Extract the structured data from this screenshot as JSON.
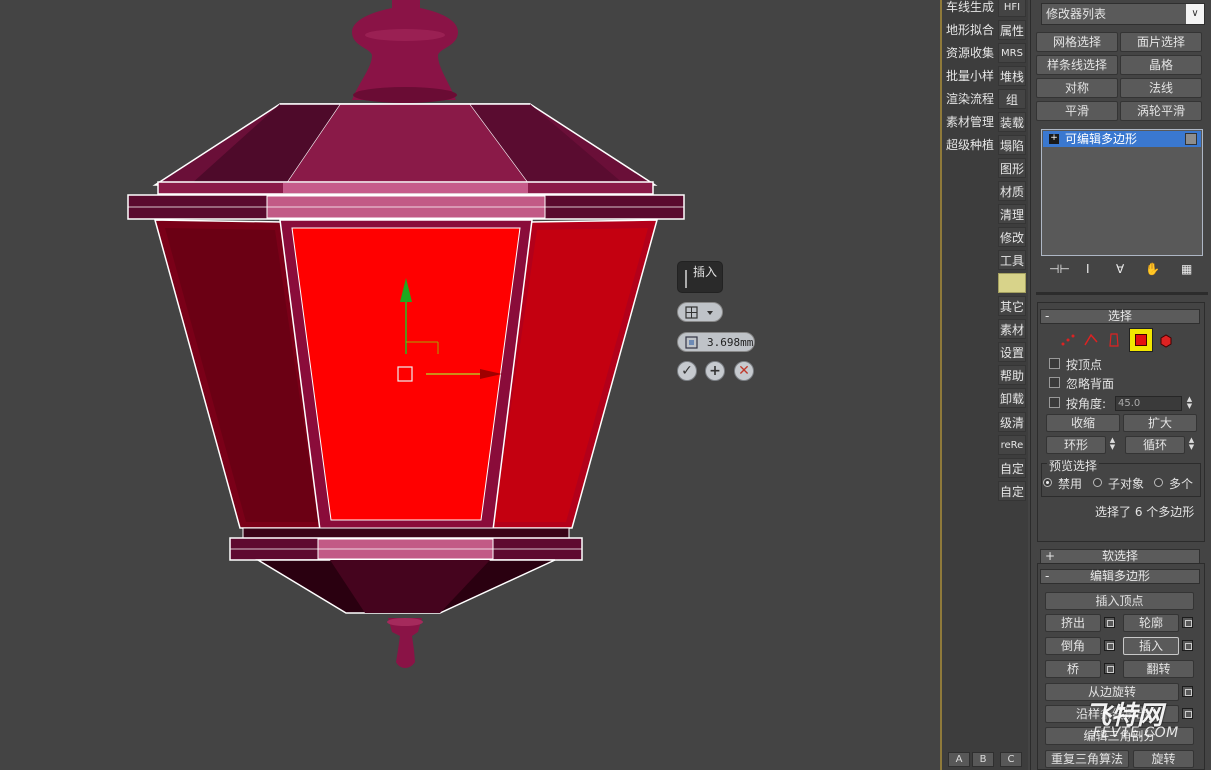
{
  "viewport": {
    "caddy_title": "插入",
    "caddy_value": "3.698mm",
    "confirm_icon": "check-icon",
    "apply_icon": "plus-icon",
    "cancel_icon": "x-icon"
  },
  "tool_categories": [
    "车线生成",
    "地形拟合",
    "资源收集",
    "批量小样",
    "渲染流程",
    "素材管理",
    "超级种植"
  ],
  "tool_right": [
    "HFI",
    "属性",
    "MRS",
    "堆栈",
    "组",
    "装载",
    "塌陷",
    "图形",
    "材质",
    "清理",
    "修改",
    "工具",
    "",
    "其它",
    "素材",
    "设置",
    "帮助",
    "卸载",
    "级清",
    "reRe",
    "自定",
    "自定"
  ],
  "abc_tabs": [
    "A",
    "B",
    "C"
  ],
  "command_panel": {
    "modifier_list": "修改器列表",
    "modifier_buttons": [
      "网格选择",
      "面片选择",
      "样条线选择",
      "晶格",
      "对称",
      "法线",
      "平滑",
      "涡轮平滑"
    ],
    "stack_item": "可编辑多边形",
    "selection": {
      "title": "选择",
      "by_vertex": "按顶点",
      "ignore_backfacing": "忽略背面",
      "by_angle": "按角度:",
      "angle_value": "45.0",
      "shrink": "收缩",
      "grow": "扩大",
      "ring": "环形",
      "loop": "循环",
      "preview_title": "预览选择",
      "preview_disabled": "禁用",
      "preview_subobject": "子对象",
      "preview_multi": "多个",
      "status": "选择了 6 个多边形"
    },
    "soft_selection": "软选择",
    "edit_poly": {
      "title": "编辑多边形",
      "insert_vertex": "插入顶点",
      "extrude": "挤出",
      "outline": "轮廓",
      "bevel": "倒角",
      "inset": "插入",
      "bridge": "桥",
      "flip": "翻转",
      "hinge": "从边旋转",
      "extrude_along_spline": "沿样条线挤出",
      "edit_triangulation": "编辑三角剖分",
      "retriangulate": "重复三角算法",
      "turn": "旋转"
    }
  },
  "watermark": {
    "logo": "飞特网",
    "url": "FEVTE.COM"
  },
  "colors": {
    "viewport_bg": "#444444",
    "selected_face": "#ff0000",
    "lantern_body": "#7a0f3e",
    "stack_highlight": "#3a78d0"
  }
}
